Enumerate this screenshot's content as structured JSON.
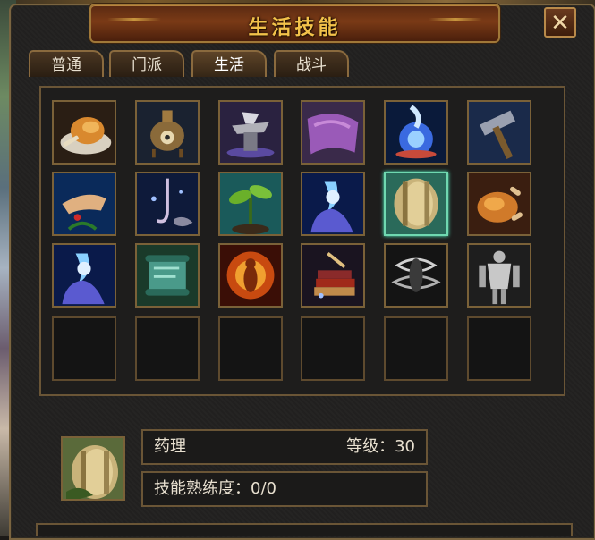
{
  "window": {
    "title": "生活技能",
    "close_label": "✕"
  },
  "tabs": [
    {
      "label": "普通",
      "active": false
    },
    {
      "label": "门派",
      "active": false
    },
    {
      "label": "生活",
      "active": true
    },
    {
      "label": "战斗",
      "active": false
    }
  ],
  "skills": [
    [
      "roast-chicken-icon",
      "alchemy-furnace-icon",
      "anvil-icon",
      "tailoring-cloth-icon",
      "glowing-orb-icon",
      "hammer-icon"
    ],
    [
      "herb-picking-icon",
      "fishing-hook-icon",
      "sprout-icon",
      "blue-flame-hand-icon",
      "millstone-icon",
      "roast-turkey-icon"
    ],
    [
      "blue-flame-hand-icon",
      "scroll-icon",
      "fire-aura-icon",
      "book-crafting-icon",
      "wind-aura-icon",
      "muscle-statue-icon"
    ],
    [
      "empty",
      "empty",
      "empty",
      "empty",
      "empty",
      "empty"
    ]
  ],
  "selected_skill": {
    "name": "药理",
    "level_label": "等级：30",
    "proficiency_label": "技能熟练度：0/0",
    "icon": "millstone-icon"
  }
}
